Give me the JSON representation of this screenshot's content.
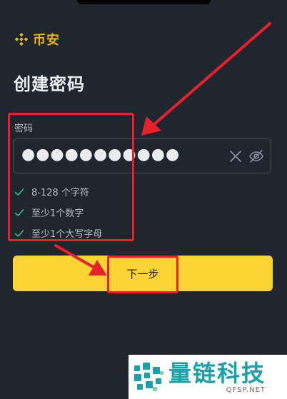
{
  "brand": {
    "name": "币安",
    "color": "#f0b90b",
    "icon": "binance-diamond-icon"
  },
  "page": {
    "title": "创建密码"
  },
  "password": {
    "label": "密码",
    "masked_value": "●●●●●●●●●●●",
    "clear_icon": "close-icon",
    "visibility_icon": "eye-off-icon"
  },
  "rules": [
    {
      "text": "8-128 个字符",
      "met": true
    },
    {
      "text": "至少1个数字",
      "met": true
    },
    {
      "text": "至少1个大写字母",
      "met": true
    }
  ],
  "next_button": {
    "label": "下一步",
    "color": "#fcd535"
  },
  "annotation": {
    "color": "#e8202a"
  },
  "watermark": {
    "title": "量链科技",
    "subtitle": "QFSP.NET"
  }
}
